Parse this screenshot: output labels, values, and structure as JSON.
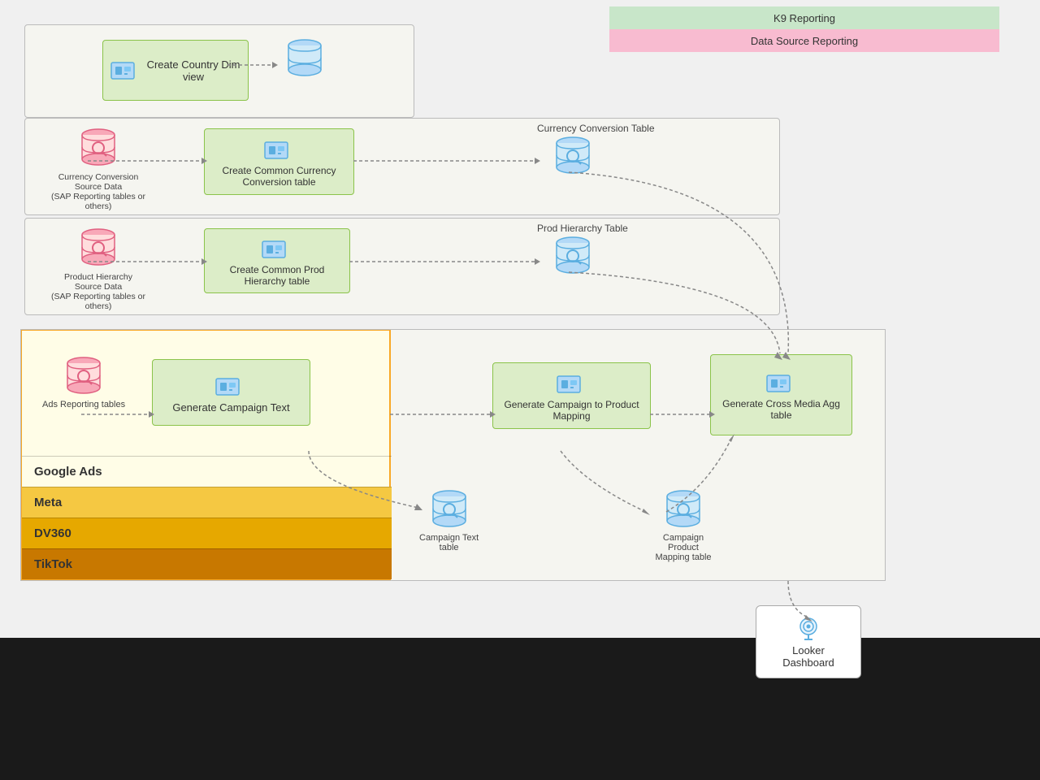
{
  "labels": {
    "k9_reporting": "K9 Reporting",
    "datasource_reporting": "Data Source Reporting",
    "create_country_dim": "Create Country Dim view",
    "create_currency_conversion": "Create Common Currency Conversion table",
    "create_prod_hierarchy": "Create Common Prod Hierarchy table",
    "generate_campaign_text": "Generate Campaign Text",
    "generate_campaign_mapping": "Generate Campaign to Product Mapping",
    "generate_cross_media": "Generate Cross Media Agg table",
    "currency_source": "Currency Conversion Source Data\n(SAP Reporting tables or others)",
    "prod_source": "Product Hierarchy Source Data\n(SAP Reporting tables or others)",
    "ads_reporting": "Ads Reporting tables",
    "currency_table": "Currency Conversion Table",
    "prod_hierarchy_table": "Prod Hierarchy Table",
    "campaign_text_table": "Campaign Text\ntable",
    "campaign_product_table": "Campaign Product\nMapping table",
    "google_ads": "Google Ads",
    "meta": "Meta",
    "dv360": "DV360",
    "tiktok": "TikTok",
    "looker": "Looker\nDashboard"
  }
}
